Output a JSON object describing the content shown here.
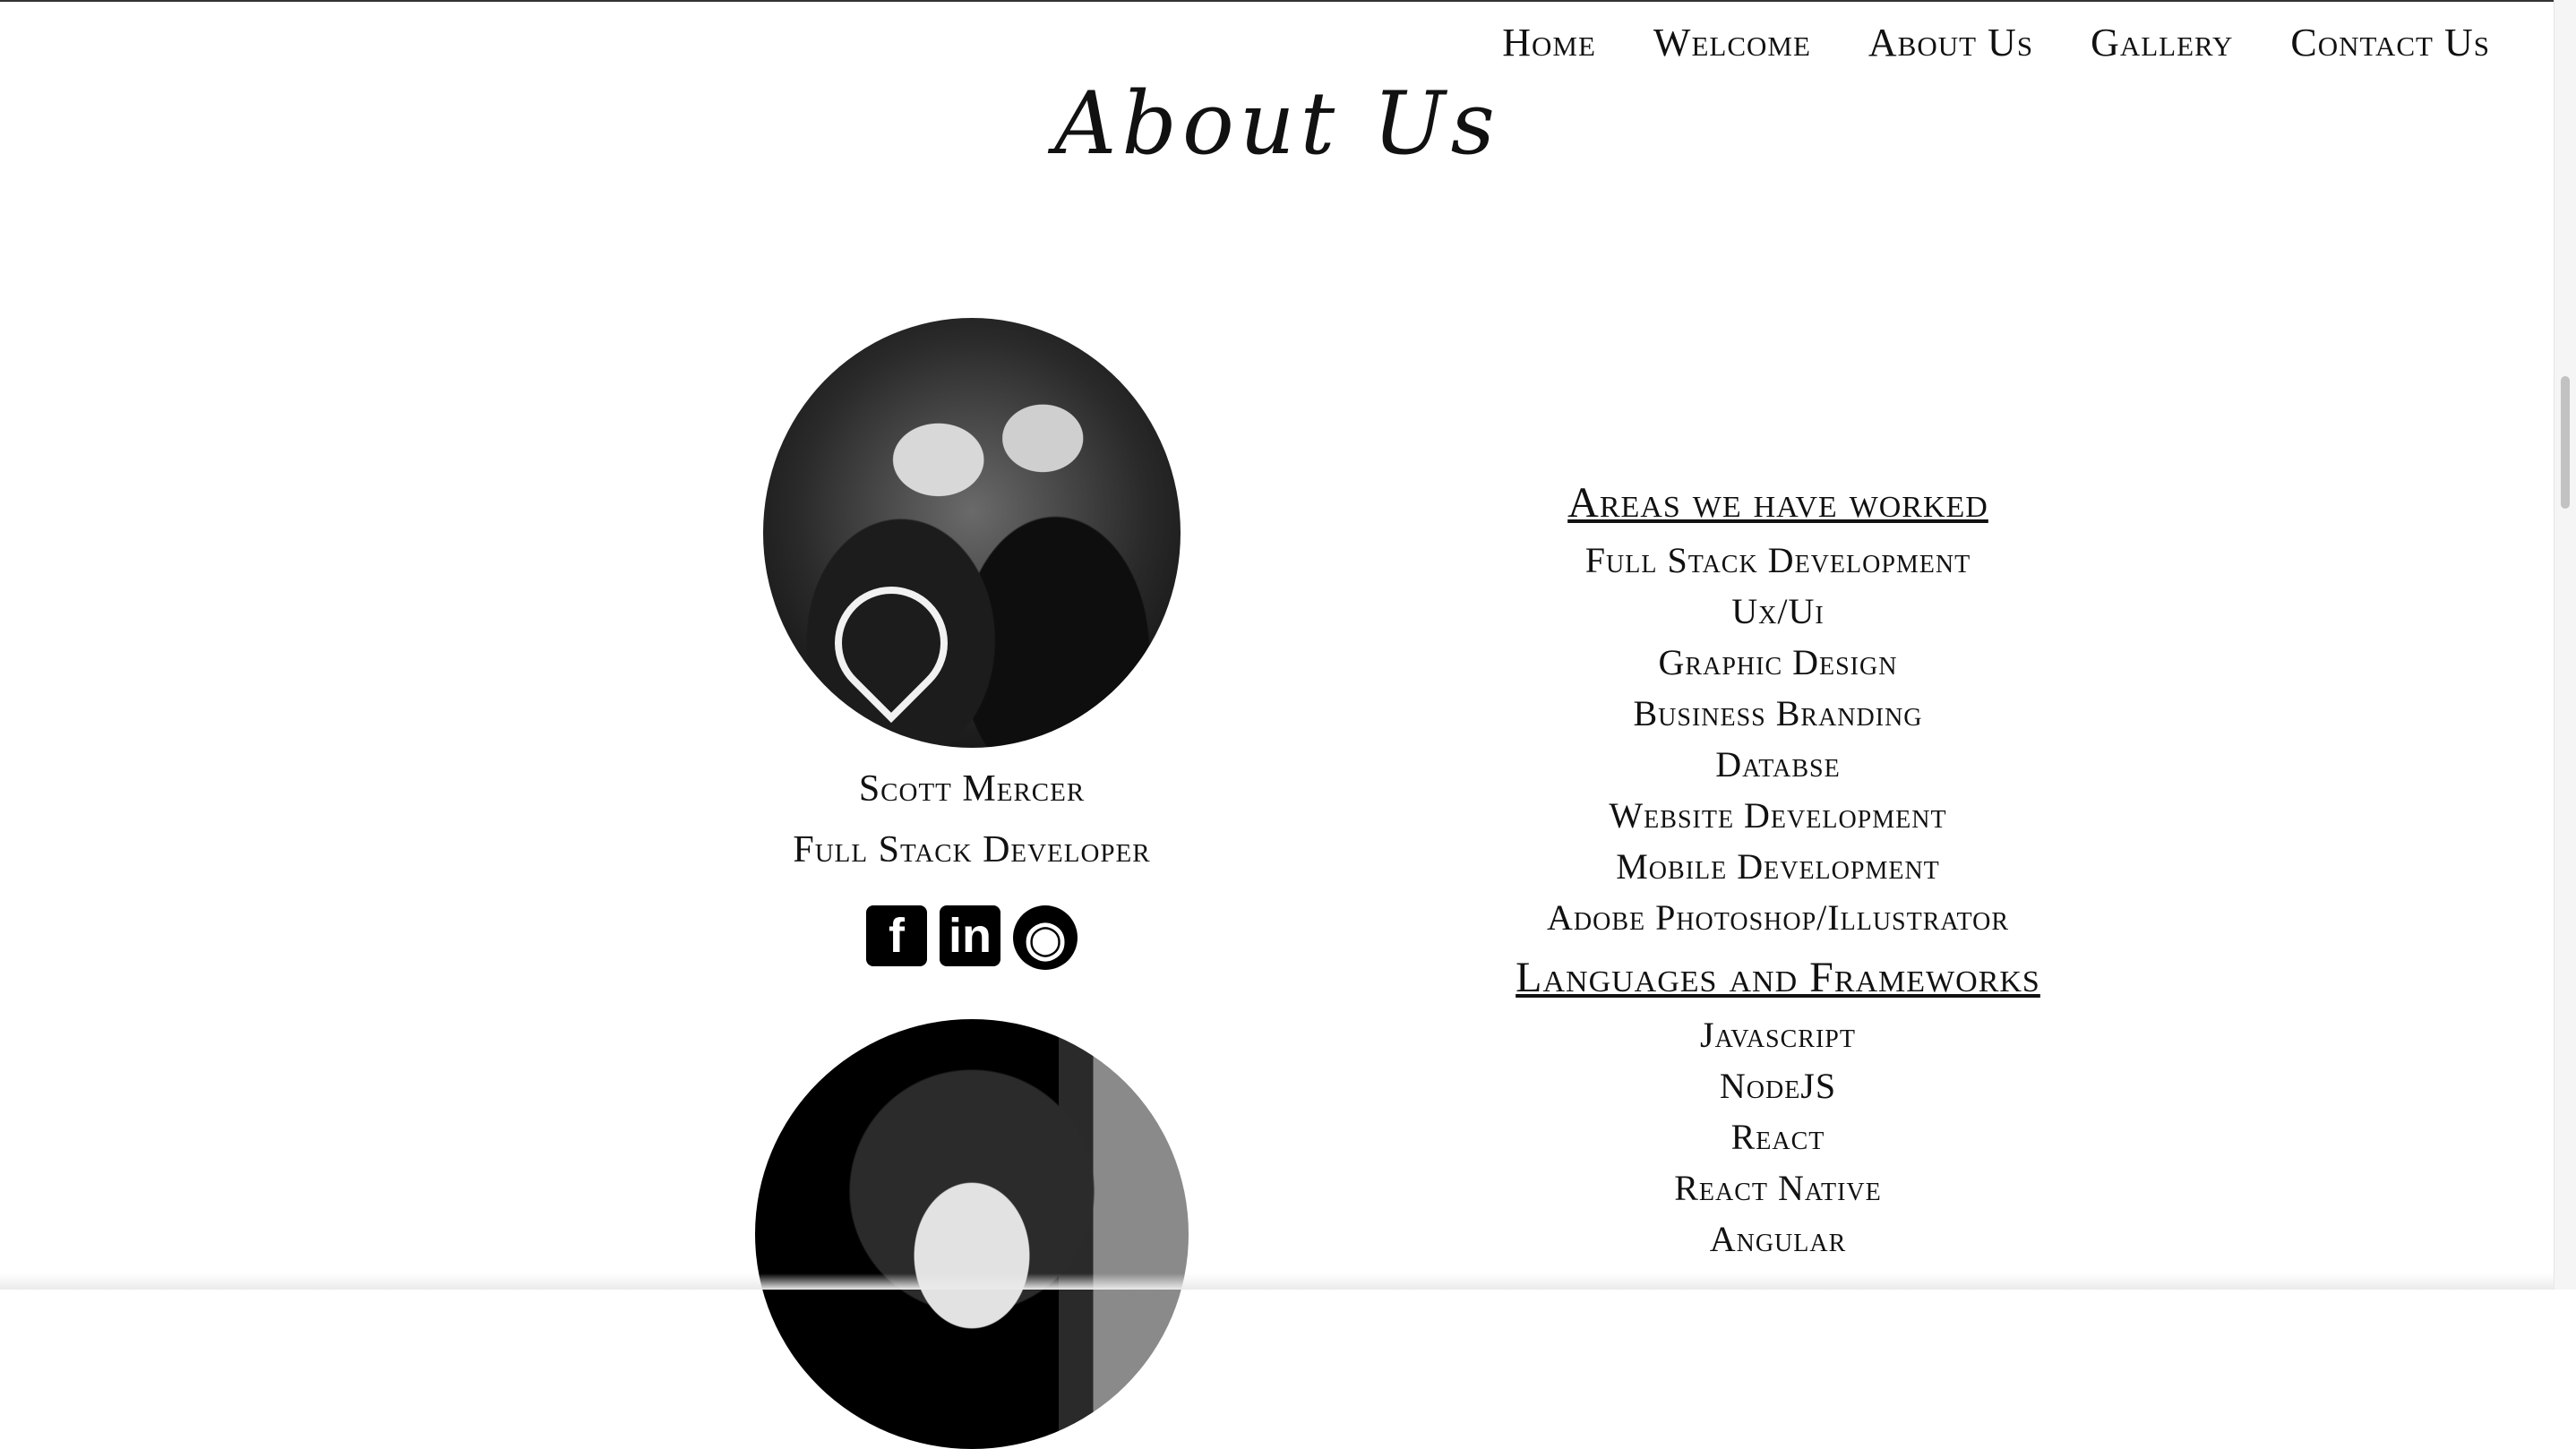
{
  "nav": {
    "items": [
      {
        "label": "Home"
      },
      {
        "label": "Welcome"
      },
      {
        "label": "About Us"
      },
      {
        "label": "Gallery"
      },
      {
        "label": "Contact Us"
      }
    ]
  },
  "page": {
    "title": "About Us"
  },
  "members": [
    {
      "name": "Scott Mercer",
      "role": "Full Stack Developer",
      "socials": [
        {
          "icon": "facebook-icon",
          "glyph": "f"
        },
        {
          "icon": "linkedin-icon",
          "glyph": "in"
        },
        {
          "icon": "github-icon",
          "glyph": "◉"
        }
      ]
    }
  ],
  "skills": {
    "areas_heading": "Areas we have worked",
    "areas": [
      "Full Stack Development",
      "Ux/Ui",
      "Graphic Design",
      "Business Branding",
      "Databse",
      "Website Development",
      "Mobile Development",
      "Adobe Photoshop/Illustrator"
    ],
    "languages_heading": "Languages and Frameworks",
    "languages": [
      "Javascript",
      "NodeJS",
      "React",
      "React Native",
      "Angular"
    ]
  }
}
